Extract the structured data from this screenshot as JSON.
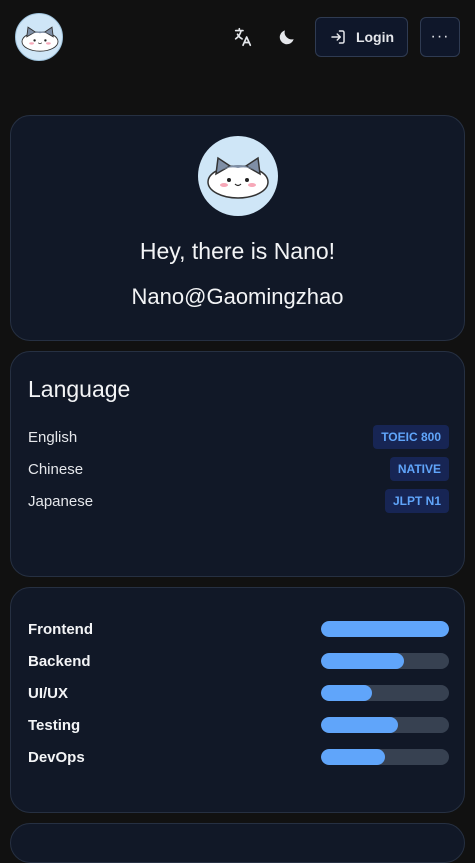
{
  "header": {
    "login_label": "Login",
    "more_label": "···"
  },
  "profile": {
    "greeting": "Hey, there is Nano!",
    "handle": "Nano@Gaomingzhao"
  },
  "language": {
    "title": "Language",
    "items": [
      {
        "name": "English",
        "level": "TOEIC 800"
      },
      {
        "name": "Chinese",
        "level": "NATIVE"
      },
      {
        "name": "Japanese",
        "level": "JLPT N1"
      }
    ]
  },
  "skills": [
    {
      "name": "Frontend",
      "percent": 100
    },
    {
      "name": "Backend",
      "percent": 65
    },
    {
      "name": "UI/UX",
      "percent": 40
    },
    {
      "name": "Testing",
      "percent": 60
    },
    {
      "name": "DevOps",
      "percent": 50
    }
  ],
  "colors": {
    "background": "#111111",
    "card": "#111827",
    "accent": "#60a5fa",
    "badge_bg": "#172554",
    "track": "#374151"
  },
  "icons": {
    "translate": "translate-icon",
    "theme": "moon-icon",
    "login": "login-icon",
    "more": "more-icon"
  }
}
